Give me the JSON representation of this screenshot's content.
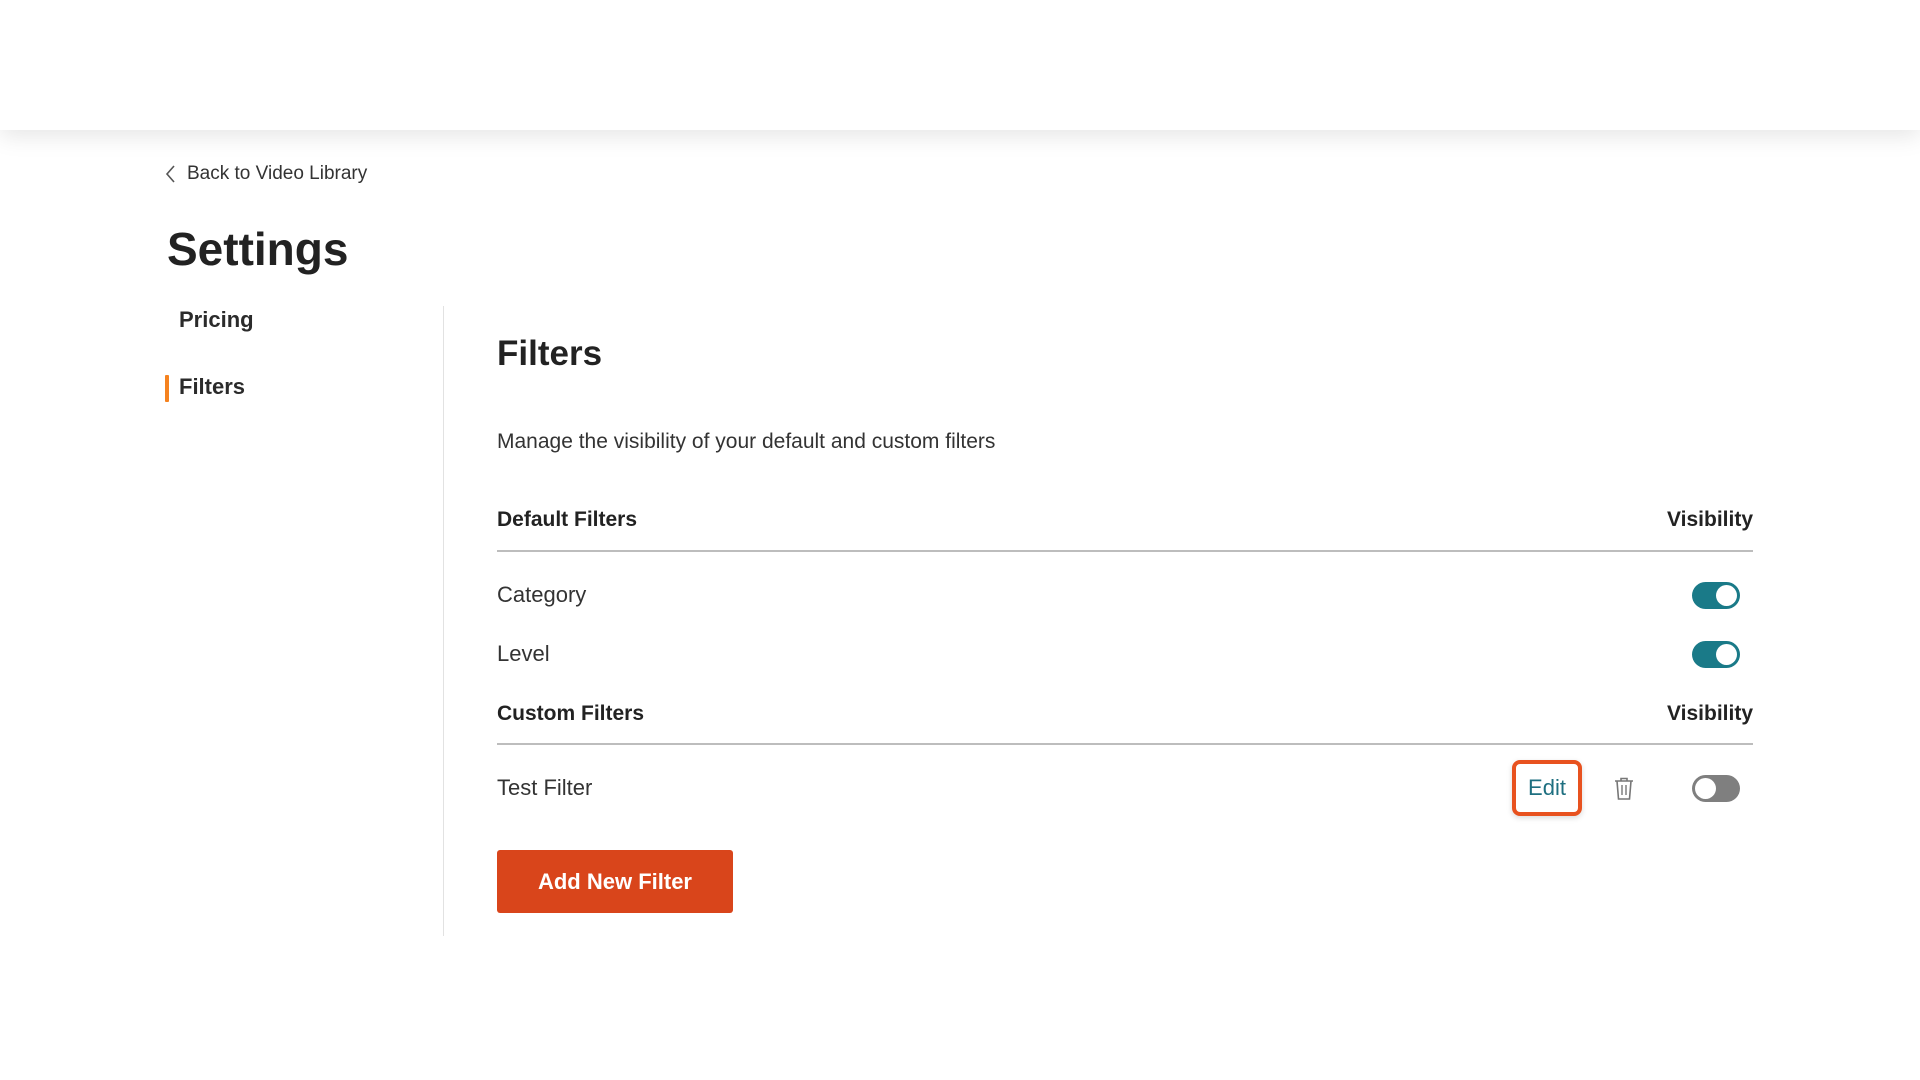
{
  "nav": {
    "back_label": "Back to Video Library"
  },
  "page": {
    "title": "Settings"
  },
  "sidebar": {
    "items": [
      {
        "label": "Pricing",
        "active": false
      },
      {
        "label": "Filters",
        "active": true
      }
    ]
  },
  "filters": {
    "title": "Filters",
    "description": "Manage the visibility of your default and custom filters",
    "default_section": {
      "heading": "Default Filters",
      "visibility_label": "Visibility",
      "rows": [
        {
          "name": "Category",
          "visible": true
        },
        {
          "name": "Level",
          "visible": true
        }
      ]
    },
    "custom_section": {
      "heading": "Custom Filters",
      "visibility_label": "Visibility",
      "rows": [
        {
          "name": "Test Filter",
          "visible": false,
          "edit_label": "Edit",
          "delete_icon": "trash-icon"
        }
      ]
    },
    "add_button_label": "Add New Filter"
  },
  "colors": {
    "accent_orange": "#f5821f",
    "primary_button": "#d9451b",
    "toggle_on": "#1a7a88",
    "toggle_off": "#7f7f7f",
    "edit_highlight": "#e8521f"
  }
}
